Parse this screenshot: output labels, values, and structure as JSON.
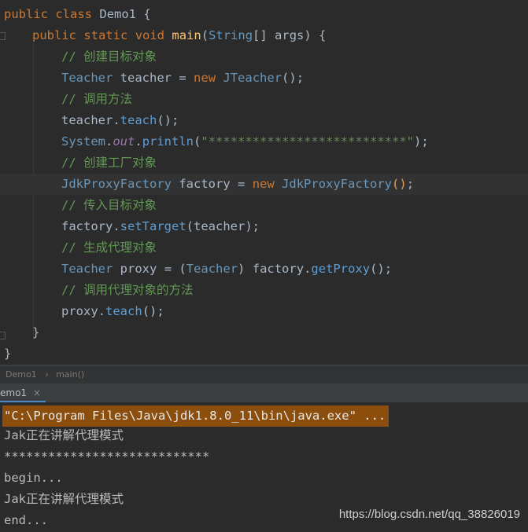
{
  "editor": {
    "line1": {
      "kw1": "public",
      "kw2": "class",
      "name": "Demo1",
      "brace": "{"
    },
    "line2": {
      "kw1": "public",
      "kw2": "static",
      "kw3": "void",
      "method": "main",
      "open": "(",
      "type": "String",
      "rest": "[] args",
      "close": ")",
      "brace": "{"
    },
    "line3": {
      "comment": "// 创建目标对象"
    },
    "line4": {
      "type1": "Teacher",
      "var": "teacher",
      "eq": "=",
      "kw": "new",
      "type2": "JTeacher",
      "paren": "();"
    },
    "line5": {
      "comment": "// 调用方法"
    },
    "line6": {
      "obj": "teacher",
      "dot": ".",
      "method": "teach",
      "paren": "();"
    },
    "line7": {
      "cls": "System",
      "dot1": ".",
      "field": "out",
      "dot2": ".",
      "method": "println",
      "open": "(",
      "str": "\"***************************\"",
      "close": ");"
    },
    "line8": {
      "comment": "// 创建工厂对象"
    },
    "line9": {
      "type1": "JdkProxyFactory",
      "var": "factory",
      "eq": "=",
      "kw": "new",
      "type2": "JdkProxyFactory",
      "paren": "()",
      "semi": ";"
    },
    "line10": {
      "comment": "// 传入目标对象"
    },
    "line11": {
      "obj": "factory",
      "dot": ".",
      "method": "setTarget",
      "args": "(teacher);"
    },
    "line12": {
      "comment": "// 生成代理对象"
    },
    "line13": {
      "type1": "Teacher",
      "var": "proxy",
      "eq": "=",
      "cast_open": "(",
      "cast_type": "Teacher",
      "cast_close": ")",
      "obj": "factory",
      "dot": ".",
      "method": "getProxy",
      "paren": "();"
    },
    "line14": {
      "comment": "// 调用代理对象的方法"
    },
    "line15": {
      "obj": "proxy",
      "dot": ".",
      "method": "teach",
      "paren": "();"
    },
    "line16": {
      "brace": "}"
    },
    "line17": {
      "brace": "}"
    }
  },
  "breadcrumb": {
    "class": "Demo1",
    "sep": "›",
    "method": "main()"
  },
  "run_tab": {
    "label": "emo1",
    "close": "×"
  },
  "console": {
    "lines": [
      "\"C:\\Program Files\\Java\\jdk1.8.0_11\\bin\\java.exe\" ...",
      "Jak正在讲解代理模式",
      "****************************",
      "begin...",
      "Jak正在讲解代理模式",
      "end..."
    ]
  },
  "watermark": "https://blog.csdn.net/qq_38826019",
  "colors": {
    "background": "#2b2b2b",
    "keyword": "#cc7832",
    "type": "#6897bb",
    "comment": "#629755",
    "string": "#6a8759",
    "cmd_highlight": "#8b4e0d"
  }
}
